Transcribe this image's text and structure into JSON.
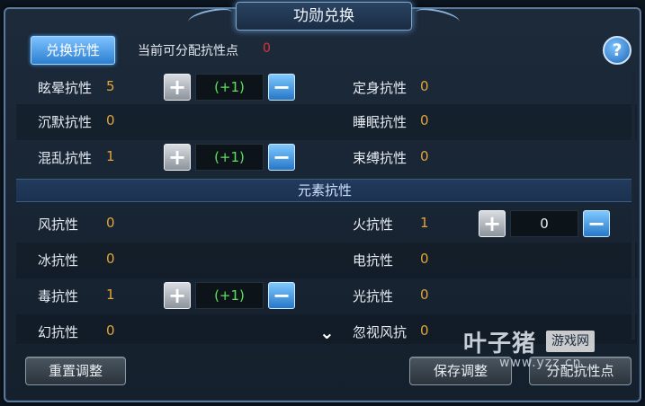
{
  "window": {
    "title": "功勋兑换"
  },
  "top_bar": {
    "switch_button": "兑换抗性",
    "allocatable_label": "当前可分配抗性点",
    "allocatable_value": "0",
    "help_icon": "?"
  },
  "rows": [
    {
      "left": {
        "label": "眩晕抗性",
        "value": "5",
        "stepper": {
          "plus": "+",
          "value": "(+1)",
          "minus": "−",
          "style": "green"
        }
      },
      "right": {
        "label": "定身抗性",
        "value": "0"
      }
    },
    {
      "left": {
        "label": "沉默抗性",
        "value": "0"
      },
      "right": {
        "label": "睡眠抗性",
        "value": "0"
      }
    },
    {
      "left": {
        "label": "混乱抗性",
        "value": "1",
        "stepper": {
          "plus": "+",
          "value": "(+1)",
          "minus": "−",
          "style": "green"
        }
      },
      "right": {
        "label": "束缚抗性",
        "value": "0"
      }
    }
  ],
  "element_section": {
    "title": "元素抗性",
    "rows": [
      {
        "left": {
          "label": "风抗性",
          "value": "0"
        },
        "right": {
          "label": "火抗性",
          "value": "1",
          "stepper": {
            "plus": "+",
            "value": "0",
            "minus": "−",
            "style": "white"
          }
        }
      },
      {
        "left": {
          "label": "冰抗性",
          "value": "0"
        },
        "right": {
          "label": "电抗性",
          "value": "0"
        }
      },
      {
        "left": {
          "label": "毒抗性",
          "value": "1",
          "stepper": {
            "plus": "+",
            "value": "(+1)",
            "minus": "−",
            "style": "green"
          }
        },
        "right": {
          "label": "光抗性",
          "value": "0"
        }
      },
      {
        "left": {
          "label": "幻抗性",
          "value": "0"
        },
        "right": {
          "label": "忽视风抗",
          "value": "0"
        }
      }
    ]
  },
  "more_icon": "⌄",
  "footer": {
    "reset_button": "重置调整",
    "save_button": "保存调整",
    "allocate_button": "分配抗性点"
  },
  "watermark": {
    "logo": "叶子猪",
    "badge": "游戏网",
    "url": "www.yzz.cn"
  },
  "colors": {
    "accent_blue": "#2b7fd0",
    "value_orange": "#e3a43a",
    "bonus_green": "#5fe05f",
    "alert_red": "#e0333a"
  }
}
